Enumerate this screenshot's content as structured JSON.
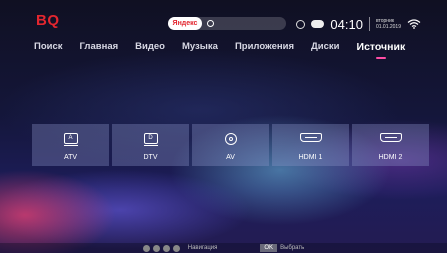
{
  "header": {
    "logo": "BQ",
    "search_brand": "Яндекс",
    "clock": "04:10",
    "weekday": "вторник",
    "date": "01.01.2019"
  },
  "nav": {
    "items": [
      "Поиск",
      "Главная",
      "Видео",
      "Музыка",
      "Приложения",
      "Диски",
      "Источник"
    ],
    "active_index": 6
  },
  "sources": [
    {
      "label": "ATV",
      "icon": "tv-a-icon",
      "glyph": "A"
    },
    {
      "label": "DTV",
      "icon": "tv-d-icon",
      "glyph": "D"
    },
    {
      "label": "AV",
      "icon": "av-icon"
    },
    {
      "label": "HDMI 1",
      "icon": "hdmi-icon"
    },
    {
      "label": "HDMI 2",
      "icon": "hdmi-icon"
    }
  ],
  "footer": {
    "navigate_label": "Навигация",
    "ok_key": "OK",
    "select_label": "Выбрать"
  },
  "colors": {
    "accent": "#e3262f",
    "underline": "#ff4da6"
  }
}
